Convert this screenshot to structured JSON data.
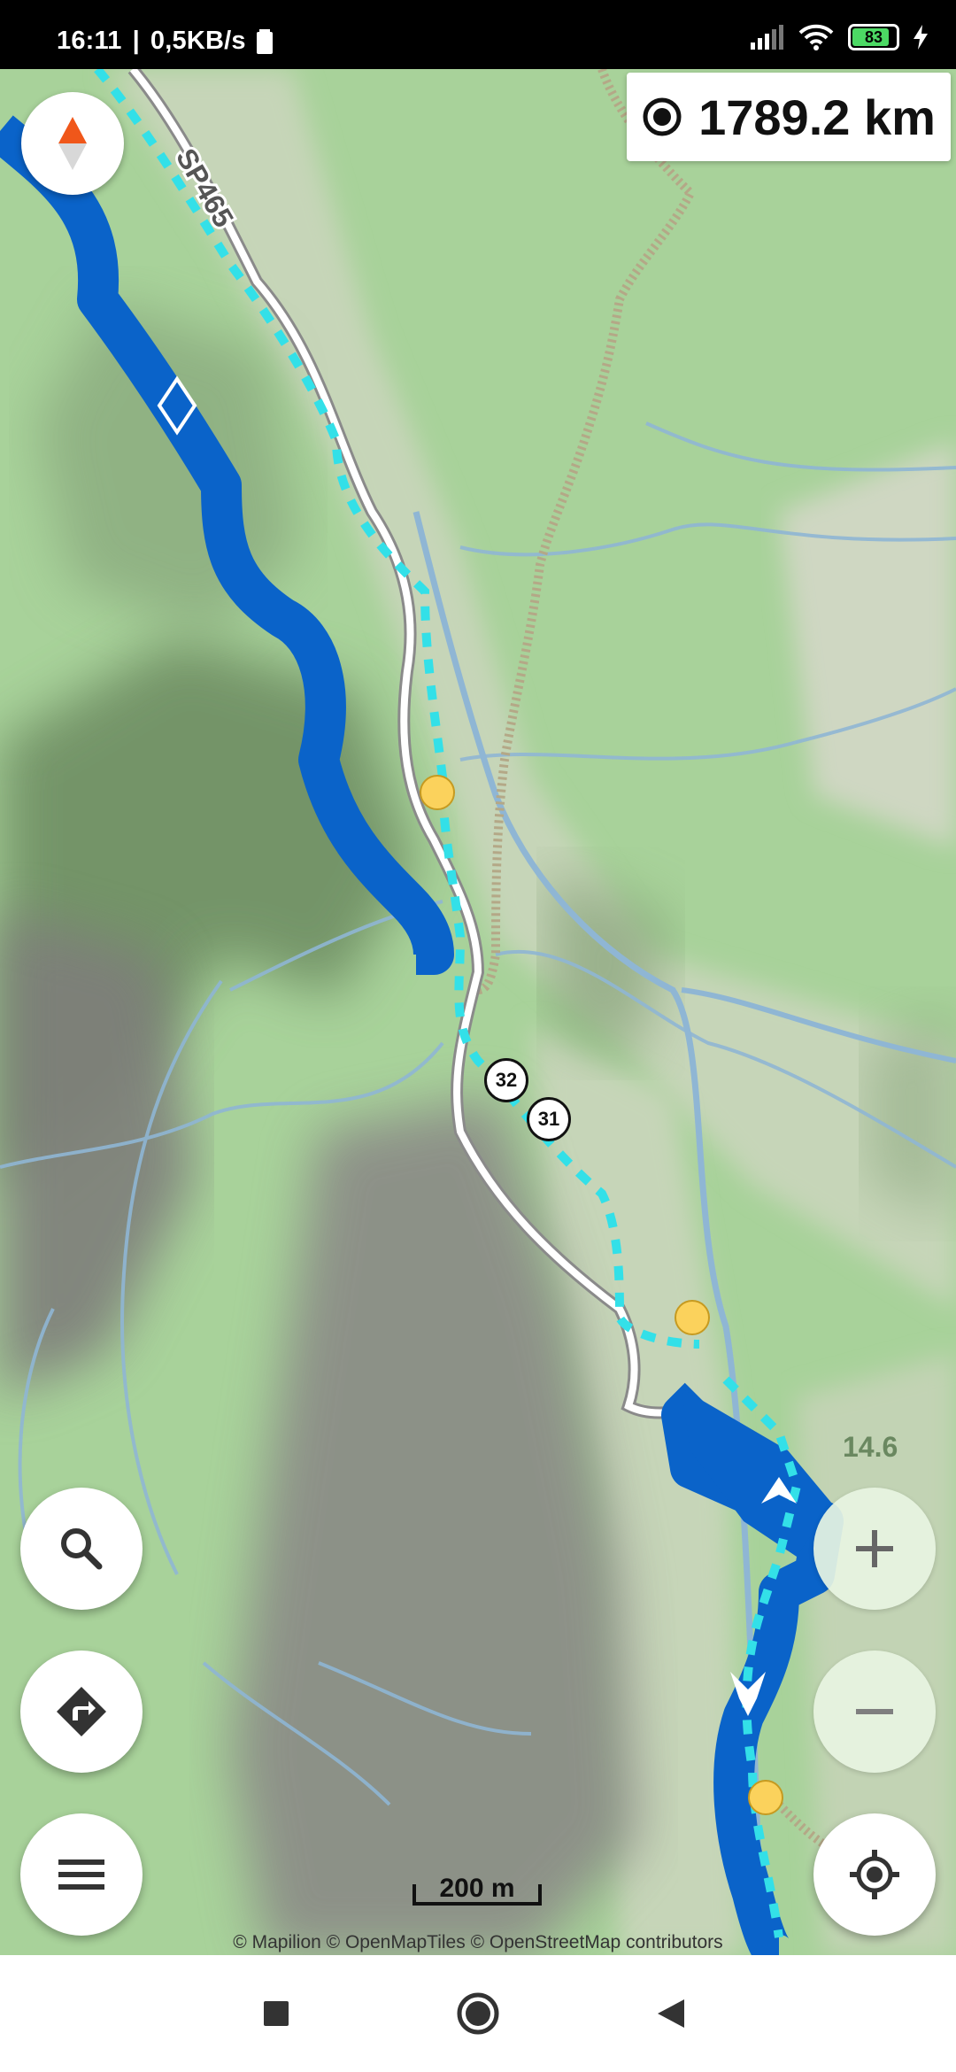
{
  "status_bar": {
    "time": "16:11",
    "speed": "0,5KB/s",
    "battery": "83"
  },
  "map": {
    "road_label": "SP465",
    "route_badges": [
      "32",
      "31"
    ],
    "zoom_level": "14.6",
    "scale_label": "200 m",
    "attribution": "© Mapilion © OpenMapTiles © OpenStreetMap contributors",
    "route_color": "#0a63c9",
    "trail_color": "#33e0e8"
  },
  "distance_box": {
    "value": "1789.2 km"
  },
  "controls": {
    "compass": "compass-icon",
    "search": "search-icon",
    "directions": "directions-icon",
    "menu": "menu-icon",
    "zoom_in": "plus-icon",
    "zoom_out": "minus-icon",
    "locate": "locate-icon"
  },
  "nav_bar": {
    "recents": "square-icon",
    "home": "circle-icon",
    "back": "triangle-back-icon"
  }
}
